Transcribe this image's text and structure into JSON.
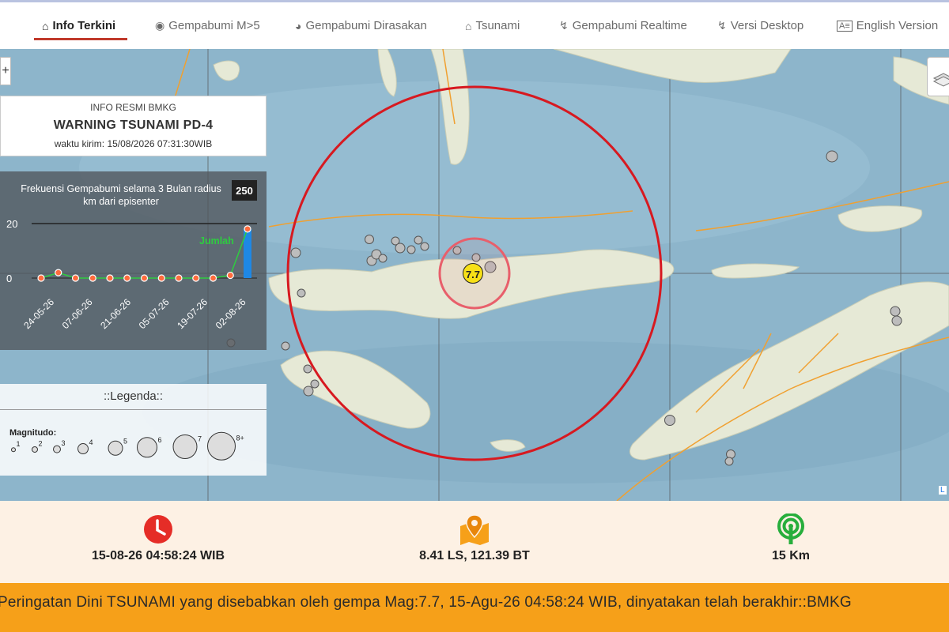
{
  "nav": {
    "items": [
      {
        "label": "Info Terkini",
        "icon": "home-icon"
      },
      {
        "label": "Gempabumi M>5",
        "icon": "target-icon"
      },
      {
        "label": "Gempabumi Dirasakan",
        "icon": "globe-icon"
      },
      {
        "label": "Tsunami",
        "icon": "home-icon"
      },
      {
        "label": "Gempabumi Realtime",
        "icon": "bolt-icon"
      },
      {
        "label": "Versi Desktop",
        "icon": "bolt-icon"
      },
      {
        "label": "English Version",
        "icon": "language-icon"
      }
    ]
  },
  "warning": {
    "header": "INFO RESMI BMKG",
    "title": "WARNING TSUNAMI PD-4",
    "sent_time": "waktu kirim: 15/08/2026 07:31:30WIB"
  },
  "chart_data": {
    "type": "line",
    "title": "Frekuensi Gempabumi selama 3 Bulan radius",
    "title_unit": "km dari episenter",
    "radius": "250",
    "series_label": "Jumlah",
    "y_ticks": [
      "20",
      "0"
    ],
    "ylim": [
      0,
      20
    ],
    "x_labels": [
      "24-05-26",
      "07-06-26",
      "21-06-26",
      "05-07-26",
      "19-07-26",
      "02-08-26"
    ],
    "values": [
      0,
      2,
      0,
      0,
      0,
      0,
      0,
      0,
      0,
      0,
      0,
      1,
      18
    ],
    "colors": {
      "line": "#2ecc40",
      "point": "#ff6b3d",
      "bar": "#1e88e5"
    }
  },
  "legend": {
    "title": "::Legenda::",
    "subtitle": "Magnitudo:",
    "mags": [
      "1",
      "2",
      "3",
      "4",
      "5",
      "6",
      "7",
      "8+"
    ]
  },
  "event": {
    "magnitude": "7.7",
    "time": "15-08-26 04:58:24 WIB",
    "location": "8.41 LS, 121.39 BT",
    "depth": "15 Km"
  },
  "ticker": "Peringatan Dini TSUNAMI yang disebabkan oleh gempa Mag:7.7, 15-Agu-26 04:58:24 WIB, dinyatakan telah berakhir::BMKG",
  "map": {
    "attribution": "L"
  },
  "colors": {
    "accent": "#c0392b",
    "ticker": "#f6a019",
    "info_bar": "#fdf1e4"
  }
}
